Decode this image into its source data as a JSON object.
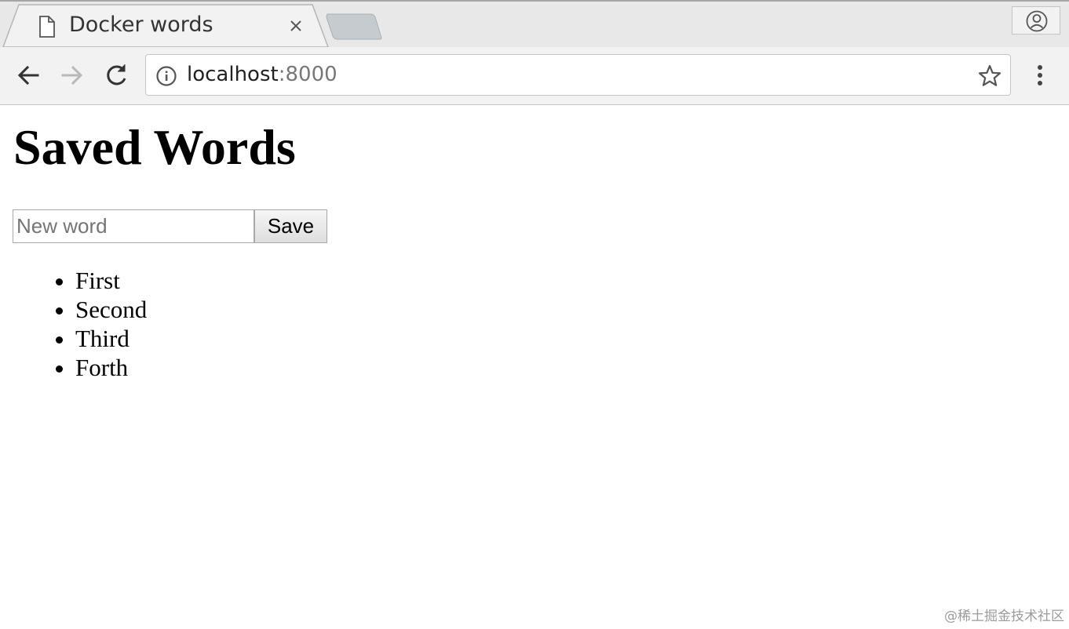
{
  "browser": {
    "tab": {
      "title": "Docker words",
      "close_icon": "close-icon",
      "page_icon": "document-icon"
    },
    "profile_icon": "account-circle-icon",
    "nav": {
      "back_icon": "arrow-left-icon",
      "forward_icon": "arrow-right-icon",
      "reload_icon": "reload-icon"
    },
    "omnibox": {
      "host": "localhost",
      "port": ":8000",
      "info_icon": "info-icon",
      "bookmark_icon": "star-icon"
    },
    "menu_icon": "kebab-menu-icon"
  },
  "page": {
    "heading": "Saved Words",
    "form": {
      "input_value": "",
      "input_placeholder": "New word",
      "save_label": "Save"
    },
    "words": [
      "First",
      "Second",
      "Third",
      "Forth"
    ]
  },
  "watermark": "@稀土掘金技术社区"
}
